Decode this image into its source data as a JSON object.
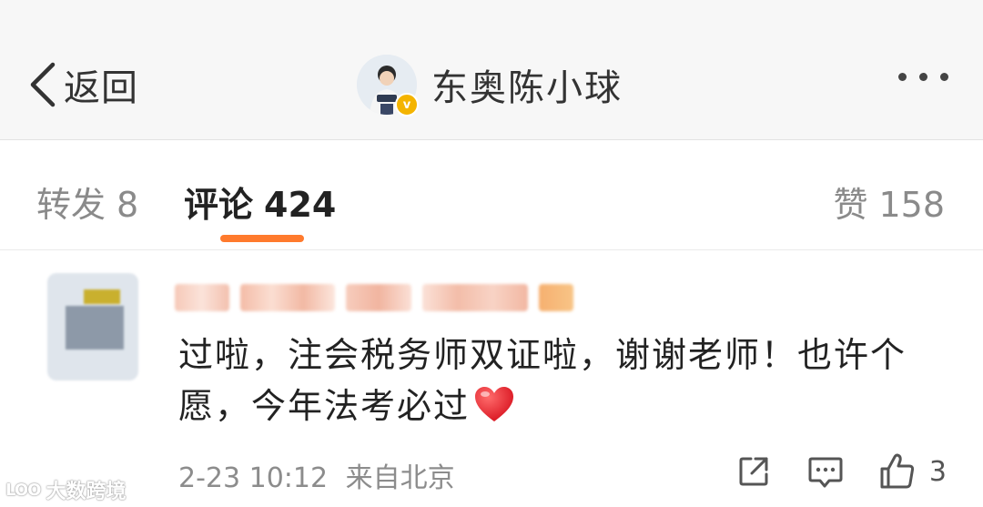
{
  "header": {
    "back_label": "返回",
    "profile_name": "东奥陈小球",
    "verified_badge": "v",
    "icons": {
      "back": "chevron-left-icon",
      "more": "more-dots-icon"
    }
  },
  "tabs": {
    "repost": {
      "label": "转发",
      "count": "8"
    },
    "comments": {
      "label": "评论",
      "count": "424"
    },
    "likes": {
      "label": "赞",
      "count": "158"
    },
    "active_color": "#ff7a2d"
  },
  "comment": {
    "text": "过啦，注会税务师双证啦，谢谢老师！也许个愿，今年法考必过",
    "emoji": "heart-emoji",
    "time": "2-23 10:12",
    "source": "来自北京",
    "like_count": "3",
    "icons": [
      "share-icon",
      "reply-icon",
      "thumbs-up-icon"
    ]
  },
  "watermark": {
    "logo": "LOO",
    "text": "大数跨境"
  }
}
